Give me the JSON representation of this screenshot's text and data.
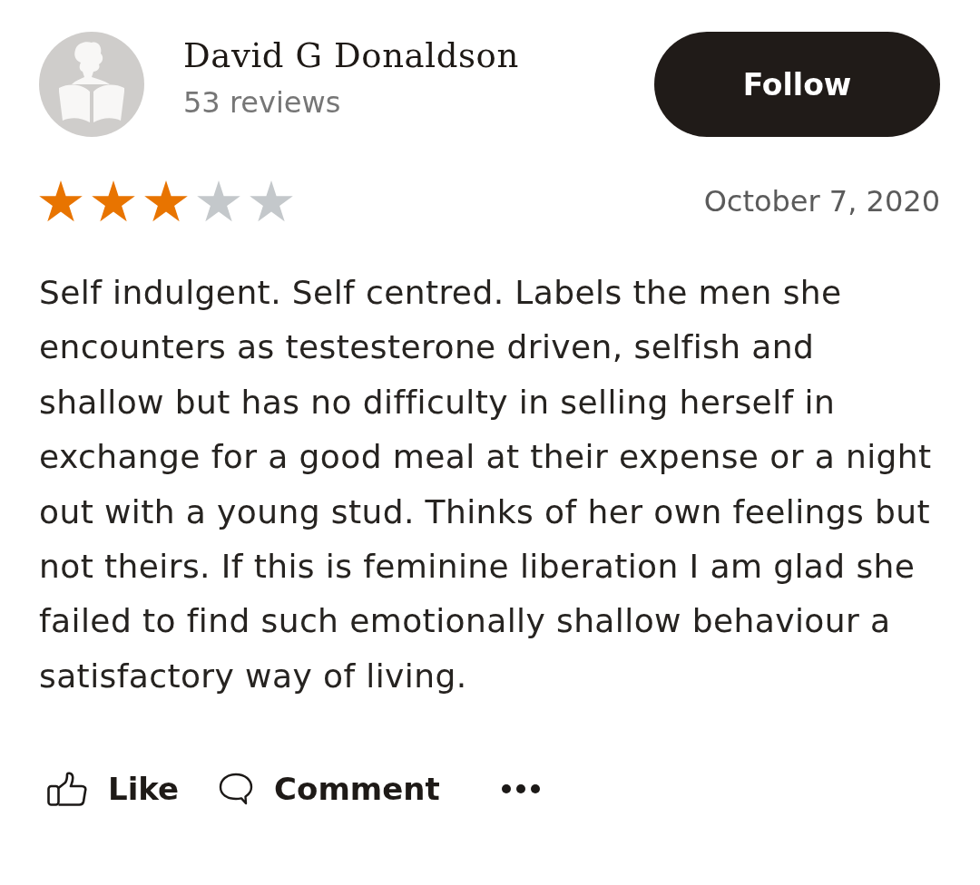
{
  "reviewer": {
    "name": "David G Donaldson",
    "review_count": "53 reviews"
  },
  "follow_button": {
    "label": "Follow"
  },
  "review": {
    "stars": 3,
    "date": "October 7, 2020",
    "text": "Self indulgent. Self centred. Labels the men she encounters as testesterone driven, selfish and shallow but has no difficulty in selling herself in exchange for a good meal at their expense or a night out with a young stud. Thinks of her own feelings but not theirs. If this is feminine liberation I am glad she failed to find such emotionally shallow behaviour a satisfactory way of living."
  },
  "actions": [
    {
      "kind": "like",
      "label": "Like"
    },
    {
      "kind": "comment",
      "label": "Comment"
    },
    {
      "kind": "more"
    }
  ]
}
